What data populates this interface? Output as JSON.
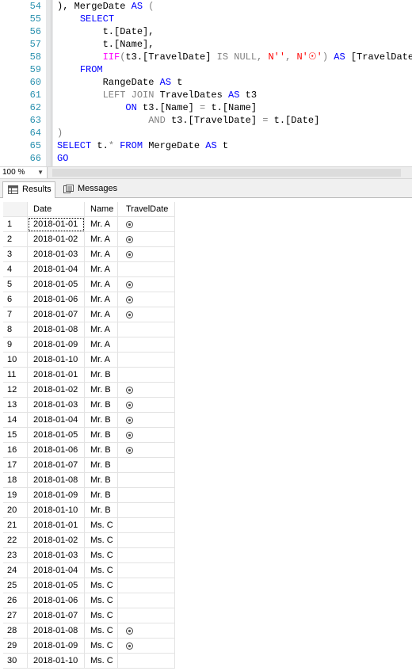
{
  "editor": {
    "line_numbers": [
      "54",
      "55",
      "56",
      "57",
      "58",
      "59",
      "60",
      "61",
      "62",
      "63",
      "64",
      "65",
      "66"
    ],
    "lines": [
      [
        {
          "c": "txt",
          "t": "), MergeDate "
        },
        {
          "c": "kw",
          "t": "AS"
        },
        {
          "c": "gray",
          "t": " ("
        }
      ],
      [
        {
          "c": "txt",
          "t": "    "
        },
        {
          "c": "kw",
          "t": "SELECT"
        }
      ],
      [
        {
          "c": "txt",
          "t": "        t.[Date],"
        }
      ],
      [
        {
          "c": "txt",
          "t": "        t.[Name],"
        }
      ],
      [
        {
          "c": "txt",
          "t": "        "
        },
        {
          "c": "fn",
          "t": "IIF"
        },
        {
          "c": "gray",
          "t": "("
        },
        {
          "c": "txt",
          "t": "t3.[TravelDate] "
        },
        {
          "c": "gray",
          "t": "IS NULL,"
        },
        {
          "c": "txt",
          "t": " "
        },
        {
          "c": "str",
          "t": "N''"
        },
        {
          "c": "gray",
          "t": ","
        },
        {
          "c": "txt",
          "t": " "
        },
        {
          "c": "str",
          "t": "N'☉'"
        },
        {
          "c": "gray",
          "t": ")"
        },
        {
          "c": "txt",
          "t": " "
        },
        {
          "c": "kw",
          "t": "AS"
        },
        {
          "c": "txt",
          "t": " [TravelDate]"
        }
      ],
      [
        {
          "c": "txt",
          "t": "    "
        },
        {
          "c": "kw",
          "t": "FROM"
        }
      ],
      [
        {
          "c": "txt",
          "t": "        RangeDate "
        },
        {
          "c": "kw",
          "t": "AS"
        },
        {
          "c": "txt",
          "t": " t"
        }
      ],
      [
        {
          "c": "txt",
          "t": "        "
        },
        {
          "c": "gray",
          "t": "LEFT JOIN"
        },
        {
          "c": "txt",
          "t": " TravelDates "
        },
        {
          "c": "kw",
          "t": "AS"
        },
        {
          "c": "txt",
          "t": " t3"
        }
      ],
      [
        {
          "c": "txt",
          "t": "            "
        },
        {
          "c": "kw",
          "t": "ON"
        },
        {
          "c": "txt",
          "t": " t3.[Name] "
        },
        {
          "c": "gray",
          "t": "="
        },
        {
          "c": "txt",
          "t": " t.[Name]"
        }
      ],
      [
        {
          "c": "txt",
          "t": "                "
        },
        {
          "c": "gray",
          "t": "AND"
        },
        {
          "c": "txt",
          "t": " t3.[TravelDate] "
        },
        {
          "c": "gray",
          "t": "="
        },
        {
          "c": "txt",
          "t": " t.[Date]"
        }
      ],
      [
        {
          "c": "gray",
          "t": ")"
        }
      ],
      [
        {
          "c": "kw",
          "t": "SELECT"
        },
        {
          "c": "txt",
          "t": " t."
        },
        {
          "c": "gray",
          "t": "*"
        },
        {
          "c": "txt",
          "t": " "
        },
        {
          "c": "kw",
          "t": "FROM"
        },
        {
          "c": "txt",
          "t": " MergeDate "
        },
        {
          "c": "kw",
          "t": "AS"
        },
        {
          "c": "txt",
          "t": " t"
        }
      ],
      [
        {
          "c": "kw",
          "t": "GO"
        }
      ]
    ]
  },
  "zoom": {
    "value": "100 %"
  },
  "tabs": {
    "results_label": "Results",
    "messages_label": "Messages"
  },
  "grid": {
    "columns": [
      "Date",
      "Name",
      "TravelDate"
    ],
    "rows": [
      {
        "n": "1",
        "date": "2018-01-01",
        "name": "Mr. A",
        "travel": true
      },
      {
        "n": "2",
        "date": "2018-01-02",
        "name": "Mr. A",
        "travel": true
      },
      {
        "n": "3",
        "date": "2018-01-03",
        "name": "Mr. A",
        "travel": true
      },
      {
        "n": "4",
        "date": "2018-01-04",
        "name": "Mr. A",
        "travel": false
      },
      {
        "n": "5",
        "date": "2018-01-05",
        "name": "Mr. A",
        "travel": true
      },
      {
        "n": "6",
        "date": "2018-01-06",
        "name": "Mr. A",
        "travel": true
      },
      {
        "n": "7",
        "date": "2018-01-07",
        "name": "Mr. A",
        "travel": true
      },
      {
        "n": "8",
        "date": "2018-01-08",
        "name": "Mr. A",
        "travel": false
      },
      {
        "n": "9",
        "date": "2018-01-09",
        "name": "Mr. A",
        "travel": false
      },
      {
        "n": "10",
        "date": "2018-01-10",
        "name": "Mr. A",
        "travel": false
      },
      {
        "n": "11",
        "date": "2018-01-01",
        "name": "Mr. B",
        "travel": false
      },
      {
        "n": "12",
        "date": "2018-01-02",
        "name": "Mr. B",
        "travel": true
      },
      {
        "n": "13",
        "date": "2018-01-03",
        "name": "Mr. B",
        "travel": true
      },
      {
        "n": "14",
        "date": "2018-01-04",
        "name": "Mr. B",
        "travel": true
      },
      {
        "n": "15",
        "date": "2018-01-05",
        "name": "Mr. B",
        "travel": true
      },
      {
        "n": "16",
        "date": "2018-01-06",
        "name": "Mr. B",
        "travel": true
      },
      {
        "n": "17",
        "date": "2018-01-07",
        "name": "Mr. B",
        "travel": false
      },
      {
        "n": "18",
        "date": "2018-01-08",
        "name": "Mr. B",
        "travel": false
      },
      {
        "n": "19",
        "date": "2018-01-09",
        "name": "Mr. B",
        "travel": false
      },
      {
        "n": "20",
        "date": "2018-01-10",
        "name": "Mr. B",
        "travel": false
      },
      {
        "n": "21",
        "date": "2018-01-01",
        "name": "Ms. C",
        "travel": false
      },
      {
        "n": "22",
        "date": "2018-01-02",
        "name": "Ms. C",
        "travel": false
      },
      {
        "n": "23",
        "date": "2018-01-03",
        "name": "Ms. C",
        "travel": false
      },
      {
        "n": "24",
        "date": "2018-01-04",
        "name": "Ms. C",
        "travel": false
      },
      {
        "n": "25",
        "date": "2018-01-05",
        "name": "Ms. C",
        "travel": false
      },
      {
        "n": "26",
        "date": "2018-01-06",
        "name": "Ms. C",
        "travel": false
      },
      {
        "n": "27",
        "date": "2018-01-07",
        "name": "Ms. C",
        "travel": false
      },
      {
        "n": "28",
        "date": "2018-01-08",
        "name": "Ms. C",
        "travel": true
      },
      {
        "n": "29",
        "date": "2018-01-09",
        "name": "Ms. C",
        "travel": true
      },
      {
        "n": "30",
        "date": "2018-01-10",
        "name": "Ms. C",
        "travel": false
      }
    ]
  }
}
